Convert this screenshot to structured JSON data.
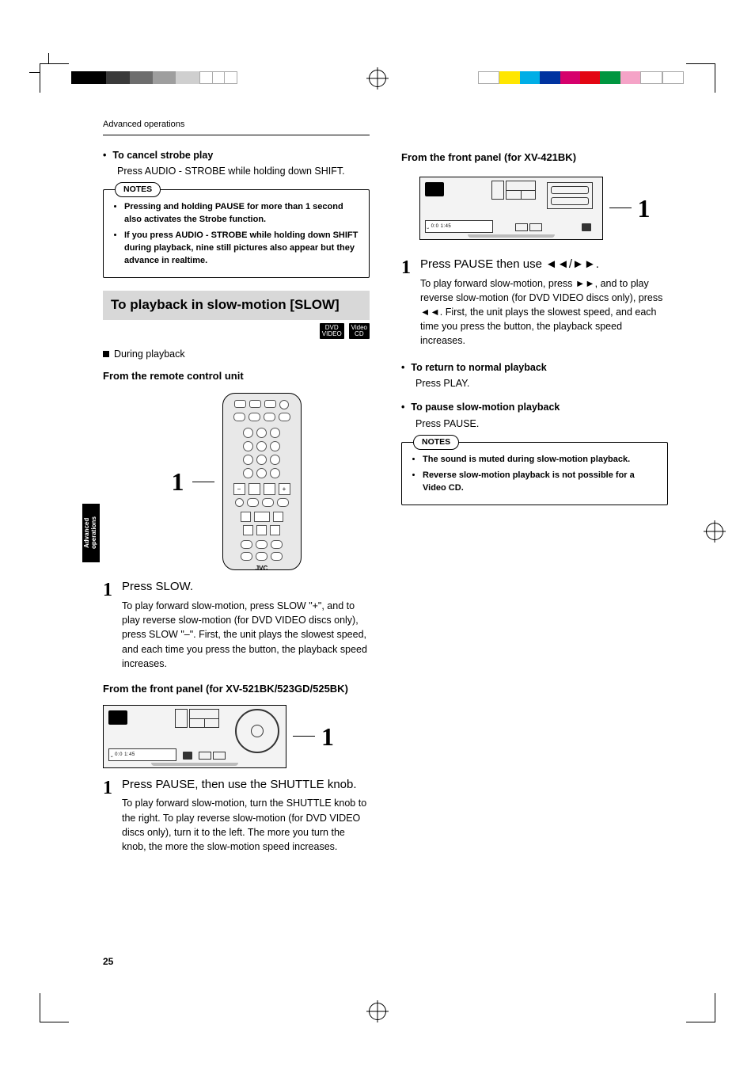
{
  "header": {
    "section": "Advanced operations"
  },
  "sidetab": "Advanced operations",
  "pageNumber": "25",
  "left": {
    "cancel": {
      "title": "To cancel strobe play",
      "body": "Press AUDIO - STROBE while holding down SHIFT."
    },
    "notes1": {
      "label": "NOTES",
      "items": [
        "Pressing and holding PAUSE for more than 1 second also activates the Strobe function.",
        "If you press AUDIO - STROBE while holding down SHIFT during playback, nine still pictures also appear but they advance in realtime."
      ]
    },
    "slowHeading": "To playback in slow-motion [SLOW]",
    "badges": {
      "dvd1": "DVD",
      "dvd2": "VIDEO",
      "vcd1": "Video",
      "vcd2": "CD"
    },
    "during": "During playback",
    "fromRemote": "From the remote control unit",
    "remoteLogo": "JVC",
    "remoteCallout": "1",
    "step1": {
      "num": "1",
      "title": "Press SLOW.",
      "body": "To play forward slow-motion, press SLOW \"+\", and to play reverse slow-motion (for DVD VIDEO discs only), press SLOW \"–\". First, the unit plays the slowest speed, and each time you press the button, the playback speed increases."
    },
    "fromPanel521": "From the front panel (for XV-521BK/523GD/525BK)",
    "panel521Callout": "1",
    "step2": {
      "num": "1",
      "title": "Press PAUSE, then use the SHUTTLE knob.",
      "body": "To play forward slow-motion, turn the SHUTTLE knob to the right. To play reverse slow-motion (for DVD VIDEO discs only), turn it to the left. The more you turn the knob, the more the slow-motion speed increases."
    }
  },
  "right": {
    "fromPanel421": "From the front panel (for XV-421BK)",
    "panel421Callout": "1",
    "step1": {
      "num": "1",
      "title_a": "Press PAUSE then use ",
      "title_glyph": "◄◄/►►",
      "title_b": ".",
      "body_a": "To play forward slow-motion, press ",
      "body_g1": "►►",
      "body_b": ", and to play reverse slow-motion (for DVD VIDEO discs only), press ",
      "body_g2": "◄◄",
      "body_c": ". First, the unit plays the slowest speed, and each time you press the button, the playback speed increases."
    },
    "returnNormal": {
      "title": "To return to normal playback",
      "body": "Press PLAY."
    },
    "pauseSlow": {
      "title": "To pause slow-motion playback",
      "body": "Press PAUSE."
    },
    "notes2": {
      "label": "NOTES",
      "items": [
        "The sound is muted during slow-motion playback.",
        "Reverse slow-motion playback is not possible for a Video CD."
      ]
    }
  },
  "colors": {
    "leftbar": [
      "#000",
      "#000",
      "#000",
      "#444",
      "#444",
      "#888",
      "#888",
      "#bbb",
      "#ddd",
      "#fff",
      "#fff",
      "#fff",
      "#fff"
    ],
    "rightbar": [
      "#fff",
      "#ffff00",
      "#00a0e0",
      "#003090",
      "#e00080",
      "#e00000",
      "#008000",
      "#f0a0c0",
      "#fff",
      "#fff"
    ]
  }
}
